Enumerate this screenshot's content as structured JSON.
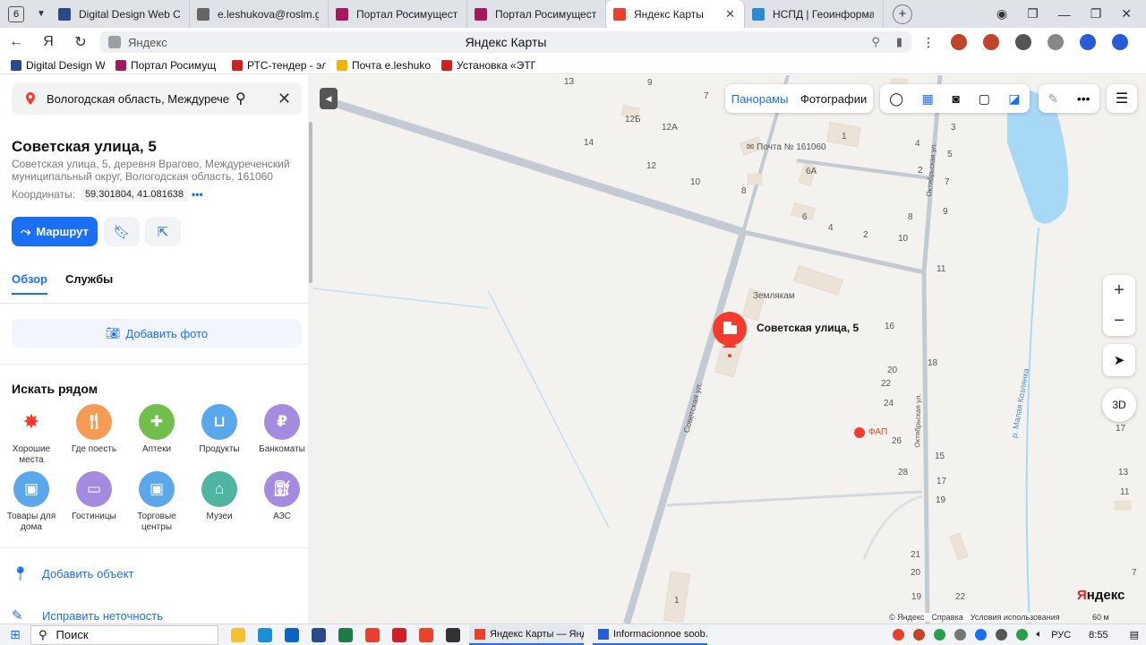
{
  "browser": {
    "tab_count": "6",
    "tabs": [
      {
        "label": "Digital Design Web Clie",
        "color": "#2a4a8a"
      },
      {
        "label": "e.leshukova@roslm.gov",
        "color": "#666666"
      },
      {
        "label": "Портал Росимущества",
        "color": "#a3195b"
      },
      {
        "label": "Портал Росимущества",
        "color": "#a3195b"
      },
      {
        "label": "Яндекс Карты",
        "color": "#e8412c"
      },
      {
        "label": "НСПД | Геоинформаци",
        "color": "#2b89d6"
      }
    ],
    "host": "Яндекс",
    "page_title": "Яндекс Карты",
    "bookmarks": [
      {
        "label": "Digital Design Web",
        "color": "#2a4a8a"
      },
      {
        "label": "Портал Росимущ",
        "color": "#a3195b"
      },
      {
        "label": "РТС-тендер - элек",
        "color": "#d02020"
      },
      {
        "label": "Почта e.leshukova",
        "color": "#f0b400"
      },
      {
        "label": "Установка «ЭТП и",
        "color": "#d02020"
      }
    ]
  },
  "search": {
    "value": "Вологодская область, Междуреченский"
  },
  "place": {
    "title": "Советская улица, 5",
    "full_address": "Советская улица, 5, деревня Врагово, Междуреченский муниципальный округ, Вологодская область, 161060",
    "coords_label": "Координаты:",
    "coords_value": "59.301804, 41.081638",
    "coords_more": "•••",
    "route_label": "Маршрут"
  },
  "tabs": {
    "overview": "Обзор",
    "services": "Службы"
  },
  "add_photo": "Добавить фото",
  "nearby": {
    "title": "Искать рядом",
    "categories": [
      {
        "label": "Хорошие места",
        "icon": "star-pin-icon",
        "color": "#ffffff"
      },
      {
        "label": "Где поесть",
        "icon": "fork-knife-icon",
        "color": "#f59b54"
      },
      {
        "label": "Аптеки",
        "icon": "pharmacy-icon",
        "color": "#6fbf4a"
      },
      {
        "label": "Продукты",
        "icon": "basket-icon",
        "color": "#5aa7ec"
      },
      {
        "label": "Банкоматы",
        "icon": "ruble-icon",
        "color": "#a58be0"
      },
      {
        "label": "Товары для дома",
        "icon": "bag-icon",
        "color": "#5aa7ec"
      },
      {
        "label": "Гостиницы",
        "icon": "bed-icon",
        "color": "#a58be0"
      },
      {
        "label": "Торговые центры",
        "icon": "bag-icon",
        "color": "#5aa7ec"
      },
      {
        "label": "Музеи",
        "icon": "museum-icon",
        "color": "#4fb5a0"
      },
      {
        "label": "АЗС",
        "icon": "fuel-icon",
        "color": "#a58be0"
      }
    ]
  },
  "actions": {
    "add_object": "Добавить объект",
    "fix_error": "Исправить неточность"
  },
  "map": {
    "pano": "Панорамы",
    "photos": "Фотографии",
    "pin_label": "Советская улица, 5",
    "labels": {
      "street1": "Советская ул.",
      "street2": "Октябрьская ул.",
      "street3": "Октябрьская ул.",
      "river": "р. Малая Козлянка",
      "post": "Почта № 161060",
      "monument": "Землякам",
      "fap": "ФАП",
      "houses": [
        "13",
        "9",
        "7",
        "12Б",
        "12А",
        "14",
        "12",
        "10",
        "8",
        "1",
        "6А",
        "6",
        "4",
        "2",
        "10",
        "2",
        "4",
        "3",
        "5",
        "7",
        "8",
        "9",
        "11",
        "16",
        "18",
        "20",
        "22",
        "24",
        "26",
        "28",
        "15",
        "17",
        "19",
        "21",
        "20",
        "19",
        "22",
        "1",
        "17",
        "13",
        "11",
        "7"
      ]
    },
    "brand_first": "Я",
    "brand_rest": "ндекс",
    "footer": [
      "© Яндекс",
      "Справка",
      "Условия использования"
    ],
    "scale": "60 м",
    "btn_3d": "3D"
  },
  "taskbar": {
    "search": "Поиск",
    "windows": [
      {
        "label": "Яндекс Карты — Янд...",
        "color": "#e8412c"
      },
      {
        "label": "Informacionnoe soob...",
        "color": "#2a5bd7"
      }
    ],
    "lang": "РУС",
    "time": "8:55"
  }
}
